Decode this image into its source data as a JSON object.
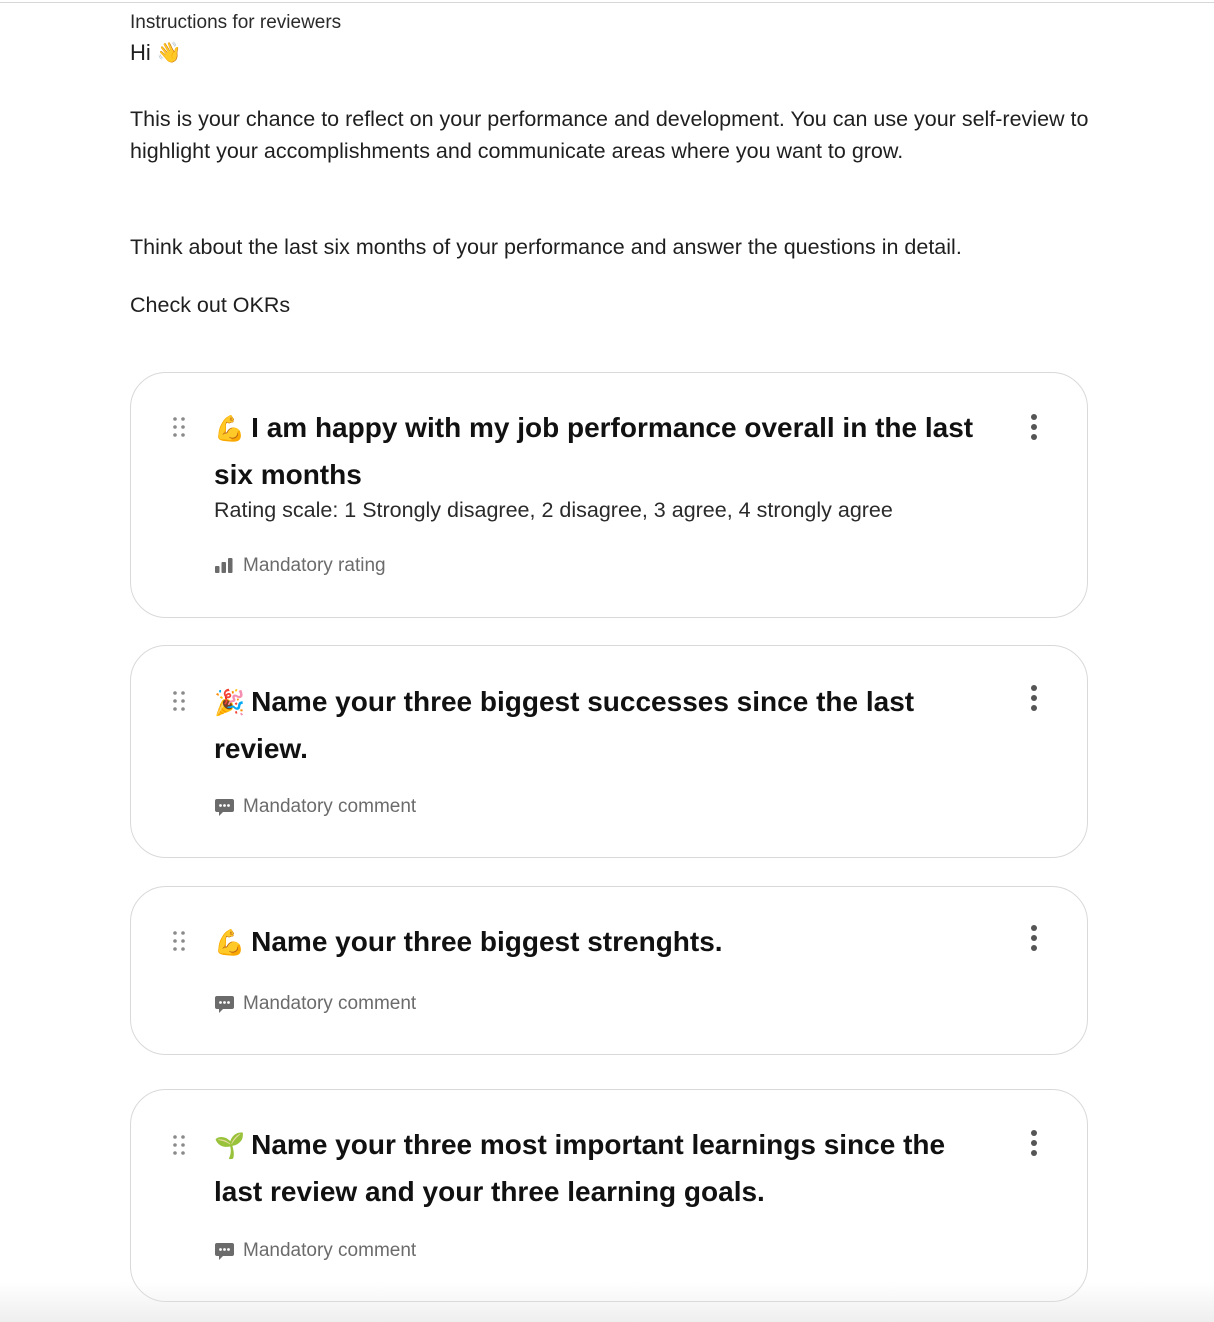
{
  "intro": {
    "label": "Instructions for reviewers",
    "greeting": "Hi",
    "greeting_icon": "waving-hand-icon",
    "paragraphs": [
      "This is your chance to reflect on your performance and development. You can use your self-review to highlight your accomplishments and communicate areas where you want to grow.",
      "Think about the last six months of your performance and answer the questions in detail.",
      "Check out OKRs"
    ]
  },
  "questions": [
    {
      "emoji": "💪",
      "emoji_name": "flexed-biceps-icon",
      "title": "I am happy with my job performance overall in the last six months",
      "description": "Rating scale: 1 Strongly disagree, 2 disagree, 3 agree, 4 strongly agree",
      "type_label": "Mandatory rating",
      "type_icon": "bar-chart-icon"
    },
    {
      "emoji": "🎉",
      "emoji_name": "party-popper-icon",
      "title": "Name your three biggest successes since the last review.",
      "type_label": "Mandatory comment",
      "type_icon": "comment-icon"
    },
    {
      "emoji": "💪",
      "emoji_name": "flexed-biceps-icon",
      "title": "Name your three biggest strenghts.",
      "type_label": "Mandatory comment",
      "type_icon": "comment-icon"
    },
    {
      "emoji": "🌱",
      "emoji_name": "seedling-icon",
      "title": "Name your three most important learnings since the last review and your three learning goals.",
      "type_label": "Mandatory comment",
      "type_icon": "comment-icon"
    }
  ],
  "colors": {
    "card_border": "#d9d9d9",
    "title_text": "#111111",
    "meta_text": "#6b6b6b",
    "handle": "#8a8a8a",
    "menu_dots": "#555555"
  }
}
